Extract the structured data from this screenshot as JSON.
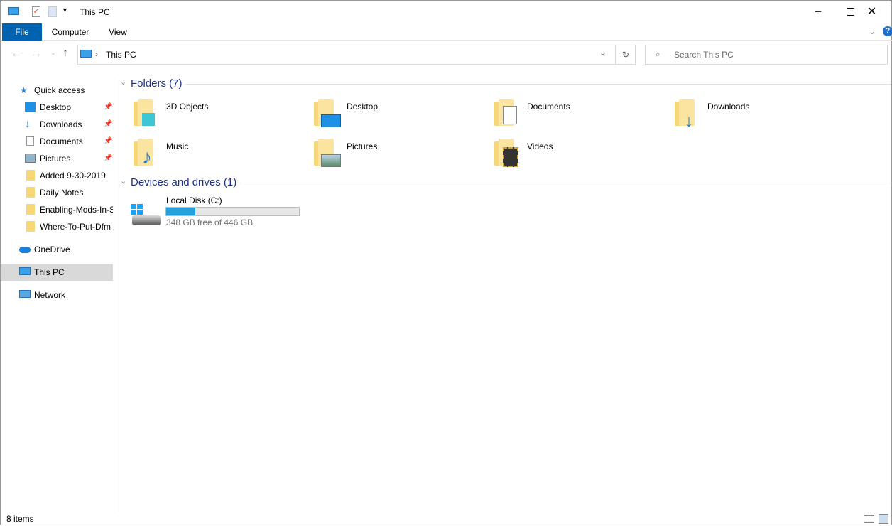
{
  "window": {
    "title": "This PC"
  },
  "ribbon": {
    "tabs": [
      "File",
      "Computer",
      "View"
    ]
  },
  "address": {
    "crumb": "This PC"
  },
  "search": {
    "placeholder": "Search This PC"
  },
  "nav": {
    "quick_access": "Quick access",
    "pinned": [
      "Desktop",
      "Downloads",
      "Documents",
      "Pictures"
    ],
    "recent": [
      "Added 9-30-2019",
      "Daily Notes",
      "Enabling-Mods-In-S",
      "Where-To-Put-Dfm"
    ],
    "onedrive": "OneDrive",
    "thispc": "This PC",
    "network": "Network"
  },
  "folders": {
    "header": "Folders (7)",
    "items": [
      "3D Objects",
      "Desktop",
      "Documents",
      "Downloads",
      "Music",
      "Pictures",
      "Videos"
    ]
  },
  "drives": {
    "header": "Devices and drives (1)",
    "items": [
      {
        "name": "Local Disk (C:)",
        "free": "348 GB free of 446 GB",
        "used_fraction": 0.22
      }
    ]
  },
  "status": {
    "count": "8 items"
  },
  "colors": {
    "accent": "#0063b1",
    "bar": "#26a0da"
  }
}
